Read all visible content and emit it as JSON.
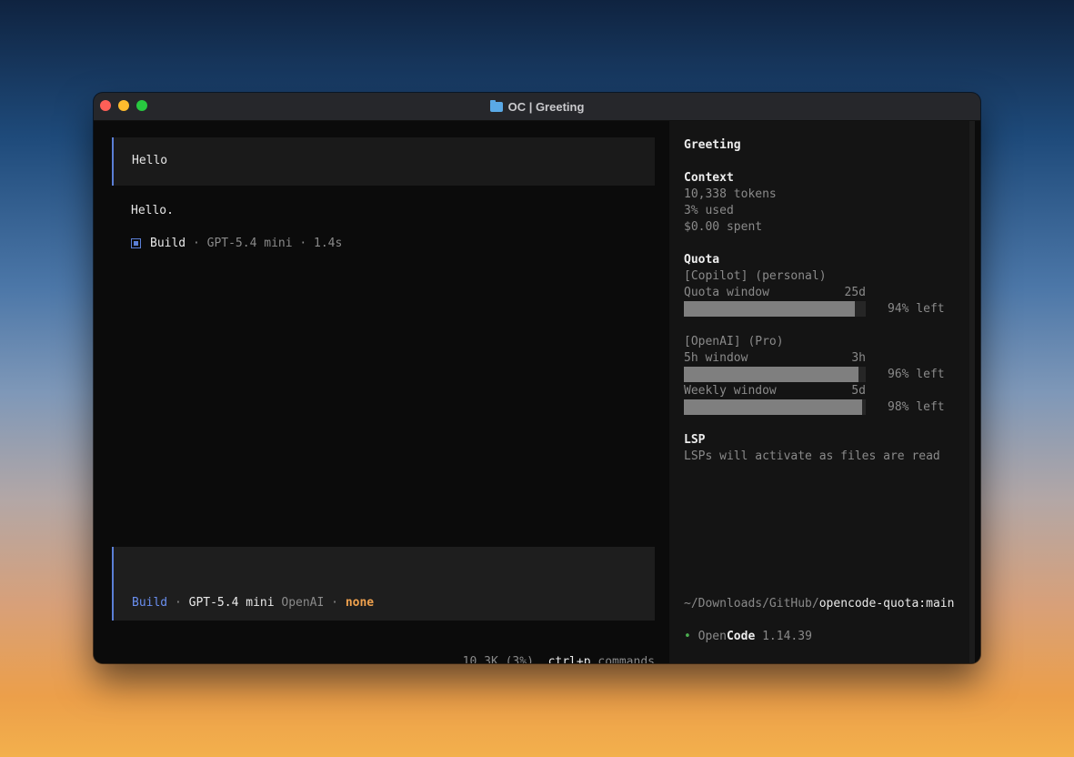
{
  "window": {
    "title": "OC | Greeting"
  },
  "chat": {
    "user_message": "Hello",
    "assistant_message": "Hello.",
    "meta": {
      "agent": "Build",
      "sep": " · ",
      "model": "GPT-5.4 mini",
      "duration": "1.4s"
    }
  },
  "prompt": {
    "agent": "Build",
    "sep": " · ",
    "model": "GPT-5.4 mini",
    "provider": "OpenAI",
    "variant": "none"
  },
  "status": {
    "tokens": "10.3K (3%)",
    "shortcut": "ctrl+p",
    "shortcut_label": "commands"
  },
  "sidebar": {
    "session_title": "Greeting",
    "context": {
      "heading": "Context",
      "tokens": "10,338 tokens",
      "used": "3% used",
      "spent": "$0.00 spent"
    },
    "quota": {
      "heading": "Quota",
      "copilot": {
        "label": "[Copilot] (personal)",
        "window_label": "Quota window",
        "window_value": "25d",
        "left_fraction": 0.94,
        "left_text": "94% left"
      },
      "openai": {
        "label": "[OpenAI] (Pro)",
        "five_h_label": "5h window",
        "five_h_value": "3h",
        "five_h_fraction": 0.96,
        "five_h_text": "96% left",
        "weekly_label": "Weekly window",
        "weekly_value": "5d",
        "weekly_fraction": 0.98,
        "weekly_text": "98% left"
      }
    },
    "lsp": {
      "heading": "LSP",
      "text": "LSPs will activate as files are read"
    },
    "path": {
      "prefix": "~/Downloads/GitHub/",
      "repo": "opencode-quota:main"
    },
    "version": {
      "dot": "•",
      "brand_a": "Open",
      "brand_b": "Code",
      "number": "1.14.39"
    }
  },
  "colors": {
    "accent": "#5b7fd6",
    "variant": "#f0a24e",
    "status_dot": "#4caf50"
  }
}
